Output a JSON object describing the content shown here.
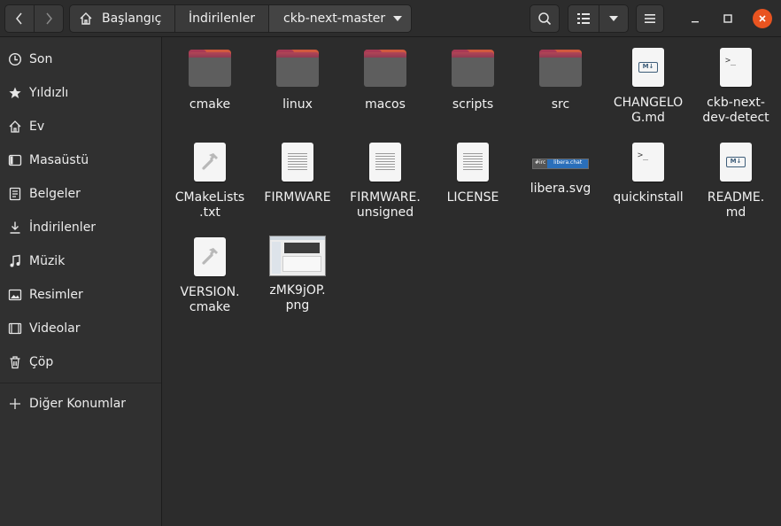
{
  "breadcrumbs": [
    "Başlangıç",
    "İndirilenler",
    "ckb-next-master"
  ],
  "sidebar": {
    "items": [
      {
        "label": "Son",
        "icon": "clock-icon"
      },
      {
        "label": "Yıldızlı",
        "icon": "star-icon"
      },
      {
        "label": "Ev",
        "icon": "home-icon"
      },
      {
        "label": "Masaüstü",
        "icon": "desktop-icon"
      },
      {
        "label": "Belgeler",
        "icon": "document-icon"
      },
      {
        "label": "İndirilenler",
        "icon": "download-icon"
      },
      {
        "label": "Müzik",
        "icon": "music-icon"
      },
      {
        "label": "Resimler",
        "icon": "picture-icon"
      },
      {
        "label": "Videolar",
        "icon": "video-icon"
      },
      {
        "label": "Çöp",
        "icon": "trash-icon"
      }
    ],
    "other_locations": "Diğer Konumlar"
  },
  "files": [
    {
      "name": "cmake",
      "kind": "folder"
    },
    {
      "name": "linux",
      "kind": "folder"
    },
    {
      "name": "macos",
      "kind": "folder"
    },
    {
      "name": "scripts",
      "kind": "folder"
    },
    {
      "name": "src",
      "kind": "folder"
    },
    {
      "name": "CHANGELOG.md",
      "kind": "markdown"
    },
    {
      "name": "ckb-next-dev-detect",
      "kind": "script"
    },
    {
      "name": "CMakeLists.txt",
      "kind": "cmake"
    },
    {
      "name": "FIRMWARE",
      "kind": "text"
    },
    {
      "name": "FIRMWARE.unsigned",
      "kind": "text"
    },
    {
      "name": "LICENSE",
      "kind": "text"
    },
    {
      "name": "libera.svg",
      "kind": "svg"
    },
    {
      "name": "quickinstall",
      "kind": "script"
    },
    {
      "name": "README.md",
      "kind": "markdown"
    },
    {
      "name": "VERSION.cmake",
      "kind": "cmake"
    },
    {
      "name": "zMK9jOP.png",
      "kind": "image"
    }
  ],
  "labels": {
    "CHANGELOG.md": [
      "CHANGELO",
      "G.md"
    ],
    "ckb-next-dev-detect": [
      "ckb-next-",
      "dev-detect"
    ],
    "CMakeLists.txt": [
      "CMakeLists",
      ".txt"
    ],
    "FIRMWARE.unsigned": [
      "FIRMWARE.",
      "unsigned"
    ],
    "README.md": [
      "README.",
      "md"
    ],
    "VERSION.cmake": [
      "VERSION.",
      "cmake"
    ],
    "zMK9jOP.png": [
      "zMK9jOP.",
      "png"
    ]
  },
  "svg_badge": {
    "left": "#irc",
    "right": "libera.chat"
  },
  "markdown_icon_text": "M↓",
  "terminal_icon_text": ">_",
  "colors": {
    "accent": "#e95420",
    "folder": "#5e5e5e",
    "folder_tab": "#a83a55"
  }
}
